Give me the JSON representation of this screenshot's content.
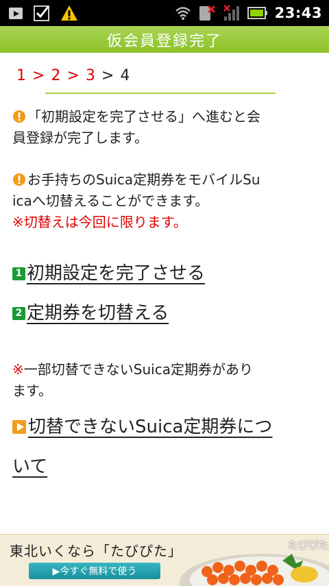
{
  "status_bar": {
    "time": "23:43",
    "icons_left": [
      "upload-icon",
      "checkbox-icon",
      "warning-icon"
    ],
    "icons_right": [
      "wifi-icon",
      "no-sim-icon",
      "signal-icon",
      "battery-icon"
    ]
  },
  "title": "仮会員登録完了",
  "steps": {
    "s1": "1",
    "s2": "2",
    "s3": "3",
    "s4": "4",
    "sep": ">"
  },
  "notice1": {
    "line1": "「初期設定を完了させる」へ進むと会",
    "line2": "員登録が完了します。"
  },
  "notice2": {
    "line1": "お手持ちのSuica定期券をモバイルSu",
    "line2": "icaへ切替えることができます。",
    "note": "※切替えは今回に限ります。"
  },
  "links": {
    "complete_setup": "初期設定を完了させる",
    "switch_pass": "定期券を切替える",
    "switch_unavailable_line1": "切替できないSuica定期券につ",
    "switch_unavailable_line2": "いて"
  },
  "notice3": {
    "mark": "※",
    "line1": "一部切替できないSuica定期券があり",
    "line2": "ます。"
  },
  "ad": {
    "headline": "東北いくなら「たびぴた」",
    "button": "▶今すぐ無料で使う",
    "logo": "たびぴた"
  },
  "colors": {
    "title_bar": "#8cc22a",
    "accent_red": "#e00000",
    "step_icon": "#1c9a36"
  }
}
